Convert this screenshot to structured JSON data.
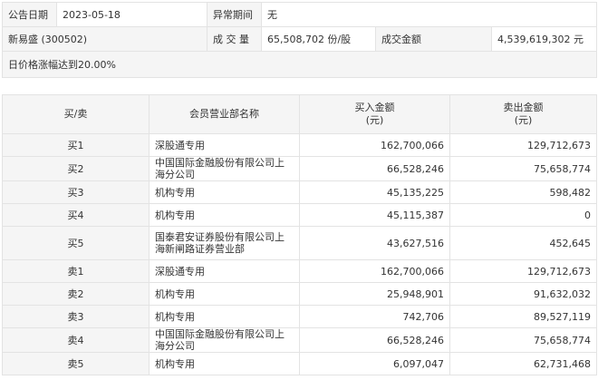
{
  "info": {
    "date_label": "公告日期",
    "date_value": "2023-05-18",
    "abnormal_label": "异常期间",
    "abnormal_value": "无",
    "stock": "新易盛 (300502)",
    "volume_label": "成 交 量",
    "volume_value": "65,508,702 份/股",
    "amount_label": "成交金额",
    "amount_value": "4,539,619,302 元",
    "reason": "日价格涨幅达到20.00%"
  },
  "table": {
    "headers": {
      "side": "买/卖",
      "name": "会员营业部名称",
      "buy_line1": "买入金额",
      "buy_line2": "(元)",
      "sell_line1": "卖出金额",
      "sell_line2": "(元)"
    },
    "rows": [
      {
        "side": "买1",
        "name": "深股通专用",
        "buy": "162,700,066",
        "sell": "129,712,673"
      },
      {
        "side": "买2",
        "name": "中国国际金融股份有限公司上海分公司",
        "buy": "66,528,246",
        "sell": "75,658,774"
      },
      {
        "side": "买3",
        "name": "机构专用",
        "buy": "45,135,225",
        "sell": "598,482"
      },
      {
        "side": "买4",
        "name": "机构专用",
        "buy": "45,115,387",
        "sell": "0"
      },
      {
        "side": "买5",
        "name": "国泰君安证券股份有限公司上海新闸路证券营业部",
        "buy": "43,627,516",
        "sell": "452,645"
      },
      {
        "side": "卖1",
        "name": "深股通专用",
        "buy": "162,700,066",
        "sell": "129,712,673"
      },
      {
        "side": "卖2",
        "name": "机构专用",
        "buy": "25,948,901",
        "sell": "91,632,032"
      },
      {
        "side": "卖3",
        "name": "机构专用",
        "buy": "742,706",
        "sell": "89,527,119"
      },
      {
        "side": "卖4",
        "name": "中国国际金融股份有限公司上海分公司",
        "buy": "66,528,246",
        "sell": "75,658,774"
      },
      {
        "side": "卖5",
        "name": "机构专用",
        "buy": "6,097,047",
        "sell": "62,731,468"
      }
    ]
  }
}
